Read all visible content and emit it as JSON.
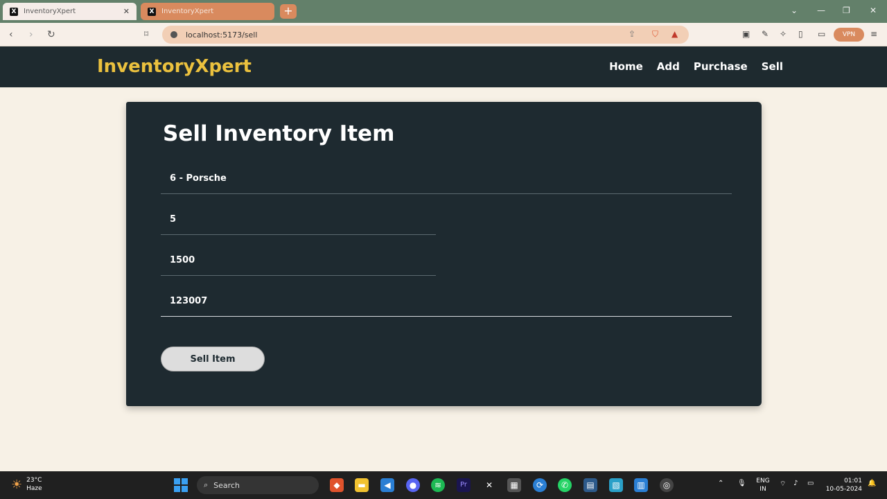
{
  "browser": {
    "tabs": [
      {
        "title": "InventoryXpert",
        "favicon": "X"
      },
      {
        "title": "InventoryXpert",
        "favicon": "X"
      }
    ],
    "url": "localhost:5173/sell",
    "vpn_label": "VPN"
  },
  "app": {
    "brand": "InventoryXpert",
    "nav": [
      "Home",
      "Add",
      "Purchase",
      "Sell"
    ],
    "colors": {
      "brand": "#ebc13e",
      "header_bg": "#1e2a2f",
      "card_bg": "#1e2a30",
      "page_bg": "#f7f1e6"
    }
  },
  "form": {
    "title": "Sell Inventory Item",
    "item_value": "6 - Porsche",
    "quantity_value": "5",
    "price_value": "1500",
    "id_value": "123007",
    "submit_label": "Sell Item"
  },
  "taskbar": {
    "weather_temp": "23°C",
    "weather_desc": "Haze",
    "search_placeholder": "Search",
    "lang_top": "ENG",
    "lang_bottom": "IN",
    "time": "01:01",
    "date": "10-05-2024"
  }
}
